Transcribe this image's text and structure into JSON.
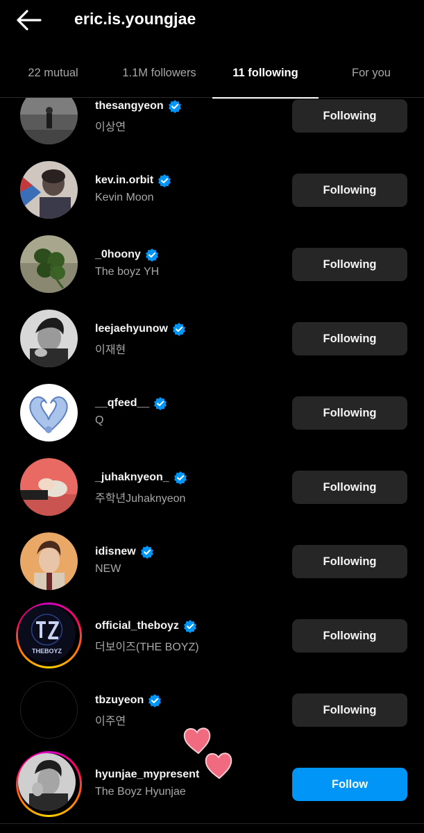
{
  "header": {
    "title": "eric.is.youngjae"
  },
  "tabs": [
    {
      "label": "22 mutual",
      "active": false
    },
    {
      "label": "1.1M followers",
      "active": false
    },
    {
      "label": "11 following",
      "active": true
    },
    {
      "label": "For you",
      "active": false
    }
  ],
  "accounts": [
    {
      "username": "thesangyeon",
      "fullname": "이상연",
      "verified": true,
      "button": "Following"
    },
    {
      "username": "kev.in.orbit",
      "fullname": "Kevin Moon",
      "verified": true,
      "button": "Following"
    },
    {
      "username": "_0hoony",
      "fullname": "The boyz YH",
      "verified": true,
      "button": "Following"
    },
    {
      "username": "leejaehyunow",
      "fullname": "이재현",
      "verified": true,
      "button": "Following"
    },
    {
      "username": "__qfeed__",
      "fullname": "Q",
      "verified": true,
      "button": "Following"
    },
    {
      "username": "_juhaknyeon_",
      "fullname": "주학년Juhaknyeon",
      "verified": true,
      "button": "Following"
    },
    {
      "username": "idisnew",
      "fullname": "NEW",
      "verified": true,
      "button": "Following"
    },
    {
      "username": "official_theboyz",
      "fullname": "더보이즈(THE BOYZ)",
      "verified": true,
      "button": "Following",
      "avatar_text": "THEBOYZ"
    },
    {
      "username": "tbzuyeon",
      "fullname": "이주연",
      "verified": true,
      "button": "Following"
    },
    {
      "username": "hyunjae_mypresent",
      "fullname": "The Boyz Hyunjae",
      "verified": false,
      "button": "Follow"
    }
  ],
  "colors": {
    "background": "#000000",
    "button_following": "#262626",
    "button_follow": "#0095f6",
    "verified_badge": "#0095f6",
    "secondary_text": "#a8a8a8",
    "heart_sticker": "#f06b80"
  }
}
